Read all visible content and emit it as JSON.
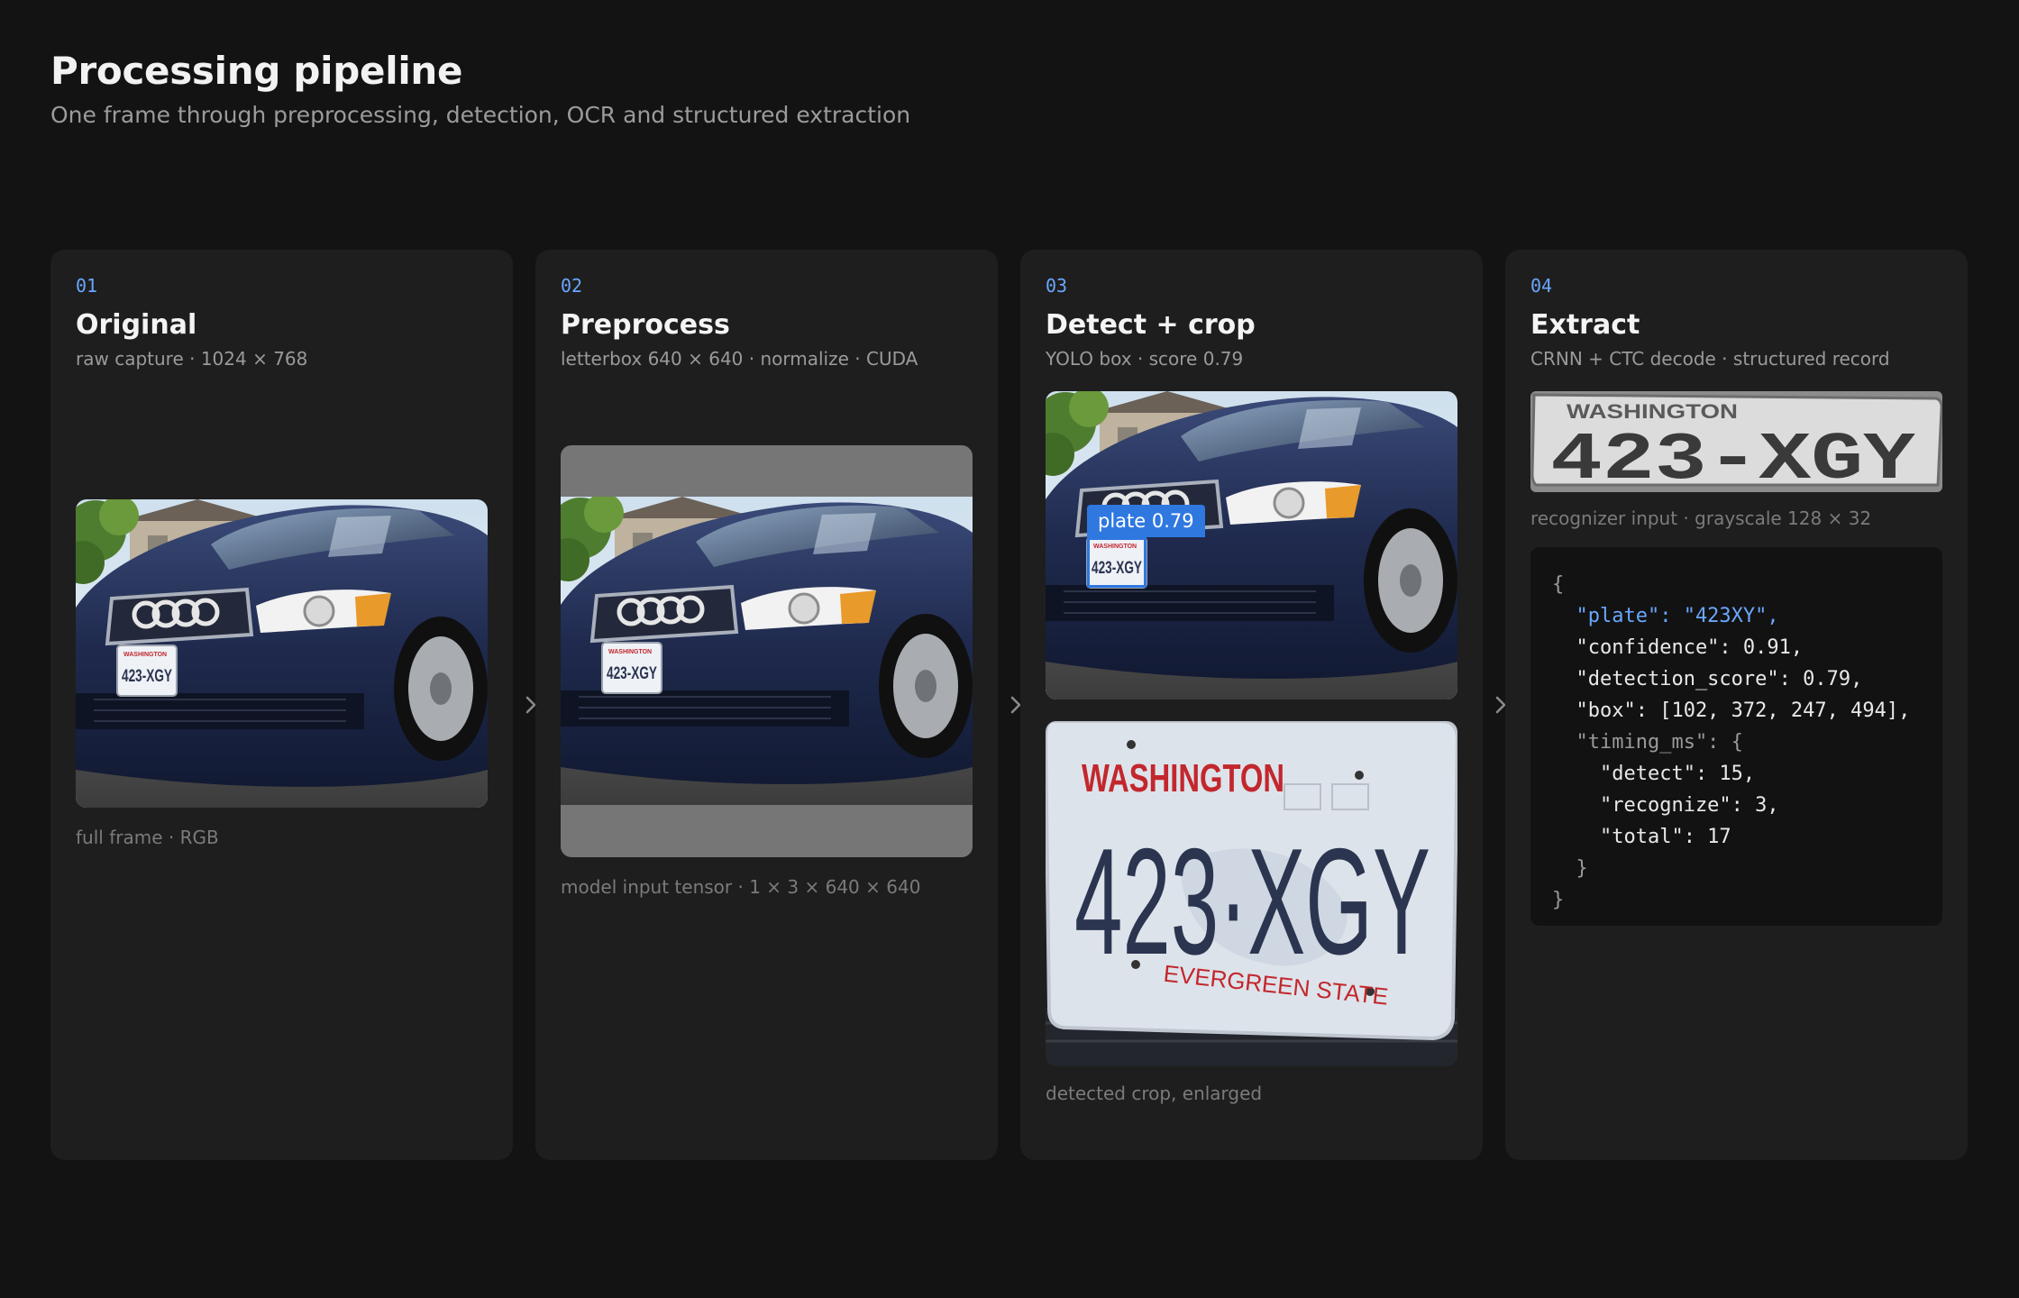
{
  "header": {
    "title": "Processing pipeline",
    "subtitle": "One frame through preprocessing, detection, OCR and structured extraction"
  },
  "stages": [
    {
      "num": "01",
      "title": "Original",
      "subtitle": "raw capture · 1024 × 768",
      "caption": "full frame · RGB"
    },
    {
      "num": "02",
      "title": "Preprocess",
      "subtitle": "letterbox 640 × 640 · normalize · CUDA",
      "caption": "model input tensor · 1 × 3 × 640 × 640"
    },
    {
      "num": "03",
      "title": "Detect + crop",
      "subtitle": "YOLO box · score 0.79",
      "caption": "detected crop, enlarged",
      "detection_label": "plate  0.79"
    },
    {
      "num": "04",
      "title": "Extract",
      "subtitle": "CRNN + CTC decode · structured record",
      "caption": "recognizer input · grayscale 128 × 32"
    }
  ],
  "plate": {
    "small_text": "423-XGY",
    "state_small": "WASHINGTON",
    "crop_state": "WASHINGTON",
    "crop_number": "423·XGY",
    "crop_slogan": "EVERGREEN STATE",
    "strip_number": "423-XGY",
    "strip_state": "WASHINGTON"
  },
  "json_lines": {
    "open": "{",
    "plate": "  \"plate\": \"423XY\",",
    "confidence": "  \"confidence\": 0.91,",
    "detection_score": "  \"detection_score\": 0.79,",
    "box": "  \"box\": [102, 372, 247, 494],",
    "timing_open": "  \"timing_ms\": {",
    "detect": "    \"detect\": 15,",
    "recognize": "    \"recognize\": 3,",
    "total": "    \"total\": 17",
    "timing_close": "  }",
    "close": "}"
  },
  "colors": {
    "accent": "#6aa7ff",
    "detection": "#2f78e0",
    "panel": "#1e1e1e",
    "background": "#131313"
  },
  "icons": {
    "stage_arrow": "chevron-right-icon"
  }
}
